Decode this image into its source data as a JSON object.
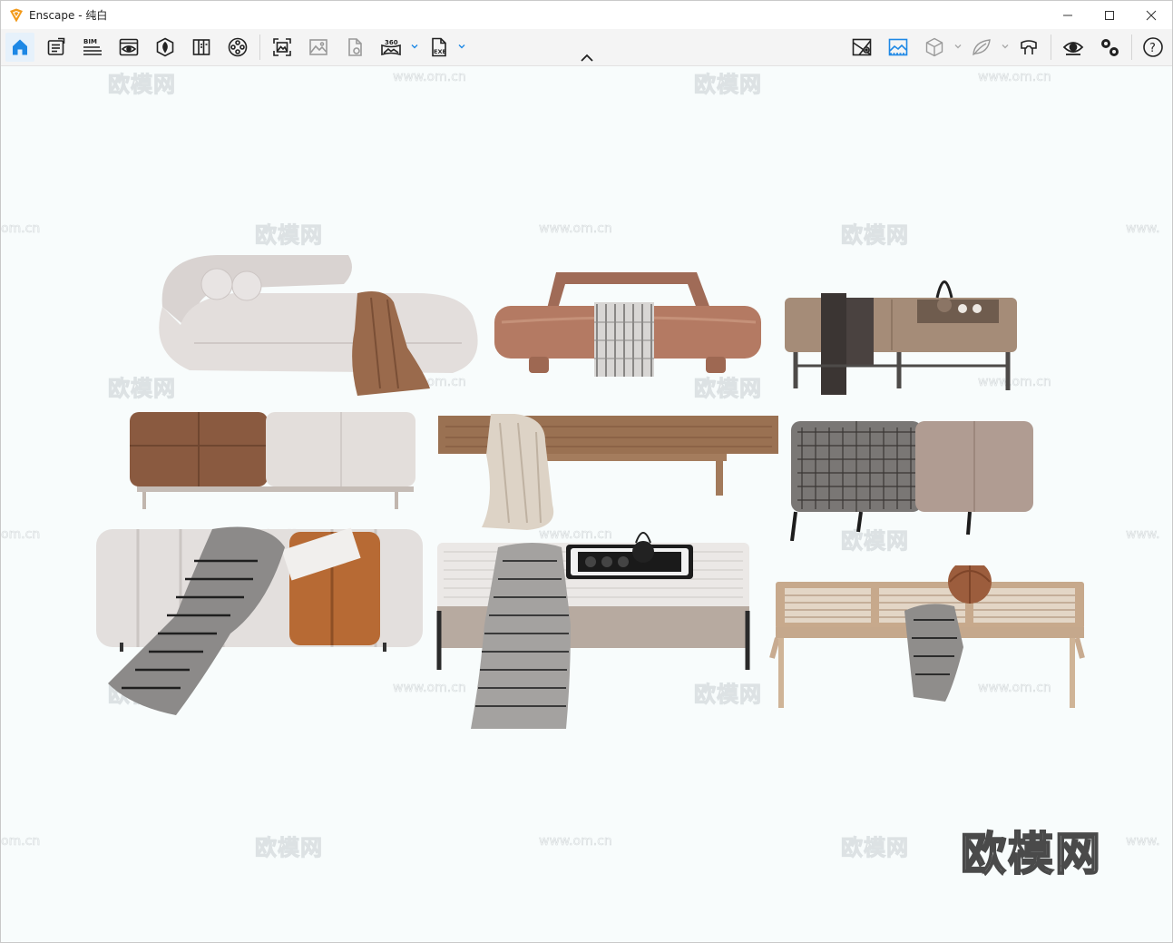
{
  "window": {
    "title": "Enscape - 纯白",
    "accent": "#1e88e5"
  },
  "toolbar": {
    "items": [
      {
        "name": "home-icon"
      },
      {
        "name": "views-list-icon"
      },
      {
        "name": "bim-icon",
        "label": "BIM"
      },
      {
        "name": "visual-settings-icon"
      },
      {
        "name": "asset-library-icon"
      },
      {
        "name": "material-editor-icon"
      },
      {
        "name": "video-editor-icon"
      },
      {
        "name": "screenshot-icon"
      },
      {
        "name": "batch-render-icon"
      },
      {
        "name": "panorama-upload-icon"
      },
      {
        "name": "panorama-360-icon",
        "label": "360"
      },
      {
        "name": "export-exe-icon",
        "label": "EXE"
      },
      {
        "name": "map-icon"
      },
      {
        "name": "sky-icon"
      },
      {
        "name": "cube-icon"
      },
      {
        "name": "leaf-icon"
      },
      {
        "name": "vr-headset-icon"
      },
      {
        "name": "eye-icon"
      },
      {
        "name": "settings-icon"
      },
      {
        "name": "help-icon",
        "label": "?"
      }
    ]
  },
  "viewport": {
    "watermark_brand": "欧模网",
    "watermark_url": "www.om.cn",
    "watermark_url_partial_left": "om.cn",
    "watermark_url_partial_right": "www.",
    "logo_text": "欧模网",
    "scene": [
      {
        "name": "chaise-lounge-cream"
      },
      {
        "name": "leather-bench-handle"
      },
      {
        "name": "bench-tea-tray"
      },
      {
        "name": "ottoman-brown-cream"
      },
      {
        "name": "wood-bench-throw"
      },
      {
        "name": "ottoman-houndstooth"
      },
      {
        "name": "tufted-bench-orange"
      },
      {
        "name": "bench-tray-teapot"
      },
      {
        "name": "rattan-bench-pouf"
      }
    ]
  }
}
